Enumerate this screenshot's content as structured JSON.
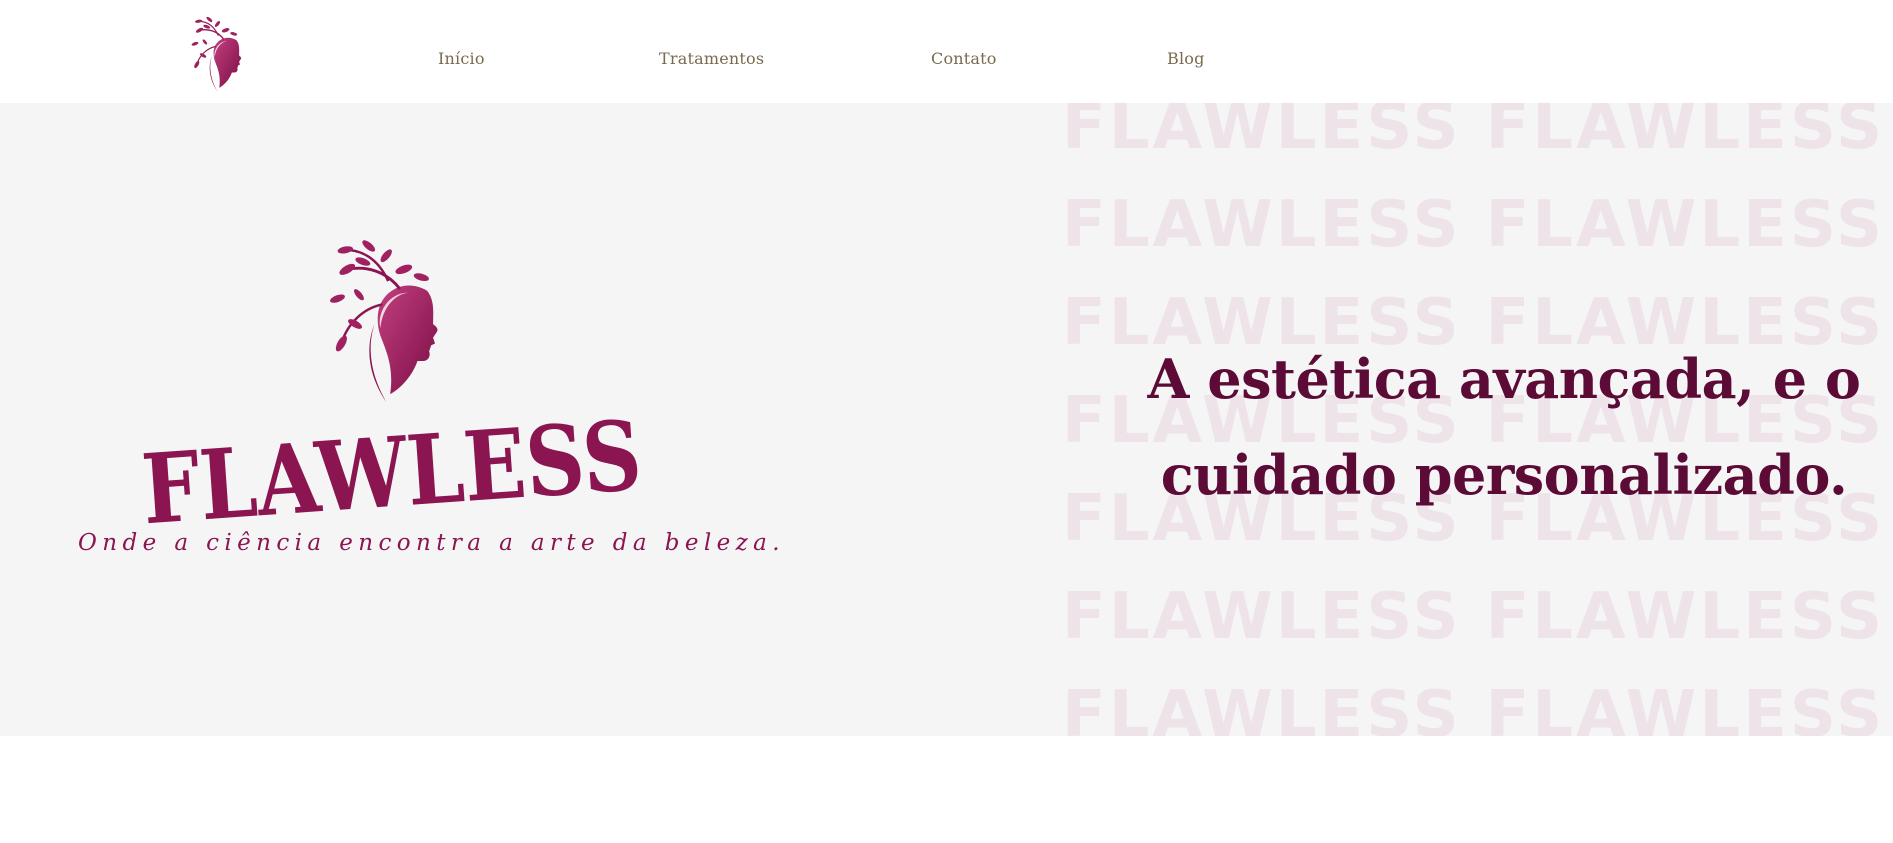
{
  "colors": {
    "brand_primary": "#8a1550",
    "brand_dark": "#5c0a36",
    "nav_text": "#7a6a4d",
    "hero_bg": "#f5f5f5",
    "pattern_text": "#ede3e9"
  },
  "header": {
    "logo_icon": "woman-profile-leaves-icon",
    "nav": [
      {
        "label": "Início"
      },
      {
        "label": "Tratamentos"
      },
      {
        "label": "Contato"
      },
      {
        "label": "Blog"
      }
    ]
  },
  "hero": {
    "brand_name": "FLAWLESS",
    "tagline": "Onde a ciência encontra a arte da beleza.",
    "headline_line1": "A estética avançada, e o",
    "headline_line2": "cuidado personalizado.",
    "pattern_word": "FLAWLESS"
  }
}
